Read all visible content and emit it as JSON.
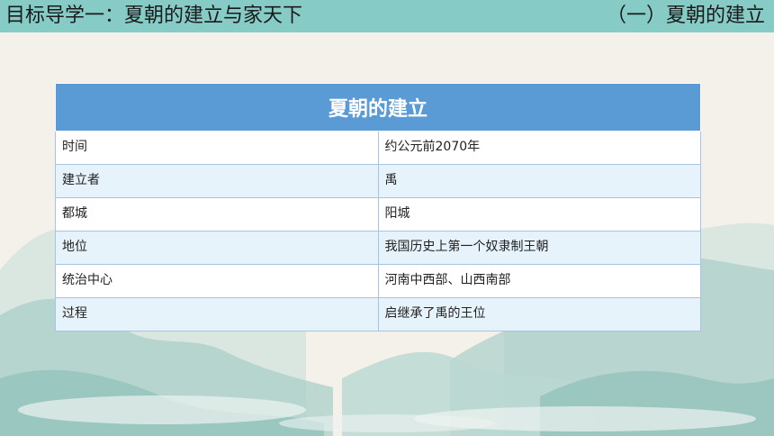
{
  "header": {
    "title": "目标导学一：夏朝的建立与家天下",
    "section": "（一）夏朝的建立"
  },
  "table": {
    "title": "夏朝的建立",
    "rows": [
      {
        "label": "时间",
        "value": "约公元前2070年"
      },
      {
        "label": "建立者",
        "value": "禹"
      },
      {
        "label": "都城",
        "value": "阳城"
      },
      {
        "label": "地位",
        "value": "我国历史上第一个奴隶制王朝"
      },
      {
        "label": "统治中心",
        "value": "河南中西部、山西南部"
      },
      {
        "label": "过程",
        "value": "启继承了禹的王位"
      }
    ]
  },
  "colors": {
    "header_bar": "#86cbc5",
    "table_header": "#5b9bd5",
    "row_alt": "#e6f3fb",
    "background": "#f4f1ea"
  }
}
